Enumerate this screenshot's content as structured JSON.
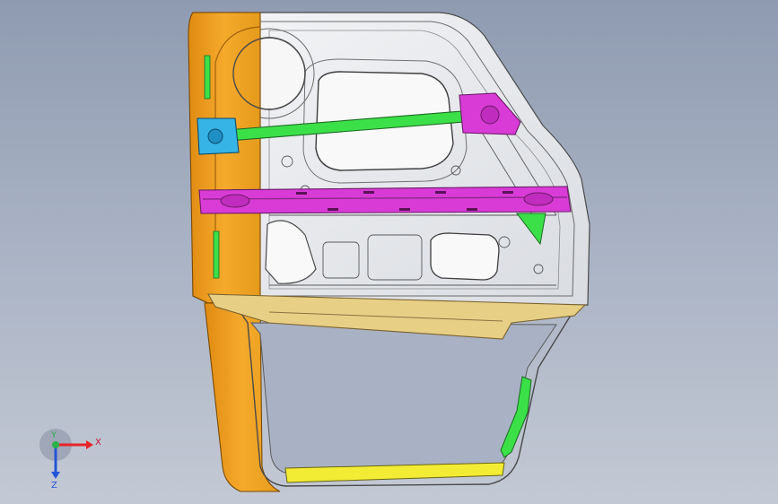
{
  "viewport": {
    "background_top": "#8f9bb1",
    "background_bottom": "#c3c9d4"
  },
  "model": {
    "parts": [
      {
        "name": "door-inner-panel",
        "color": "#e4e6ea"
      },
      {
        "name": "hinge-reinforcement",
        "color": "#f0a526"
      },
      {
        "name": "upper-cross-beam",
        "color": "#3be048"
      },
      {
        "name": "impact-beam",
        "color": "#d93bd6"
      },
      {
        "name": "hinge-bracket",
        "color": "#36b4e6"
      },
      {
        "name": "latch-bracket",
        "color": "#d93bd6"
      },
      {
        "name": "belt-line-reinforcement",
        "color": "#e8cf86"
      },
      {
        "name": "window-frame-lower",
        "color": "#f3ec35"
      },
      {
        "name": "window-frame-rear-channel",
        "color": "#3be048"
      }
    ]
  },
  "triad": {
    "x_label": "X",
    "y_label": "Y",
    "z_label": "Z",
    "x_color": "#e8232a",
    "y_color": "#2bb24a",
    "z_color": "#2355d8"
  }
}
